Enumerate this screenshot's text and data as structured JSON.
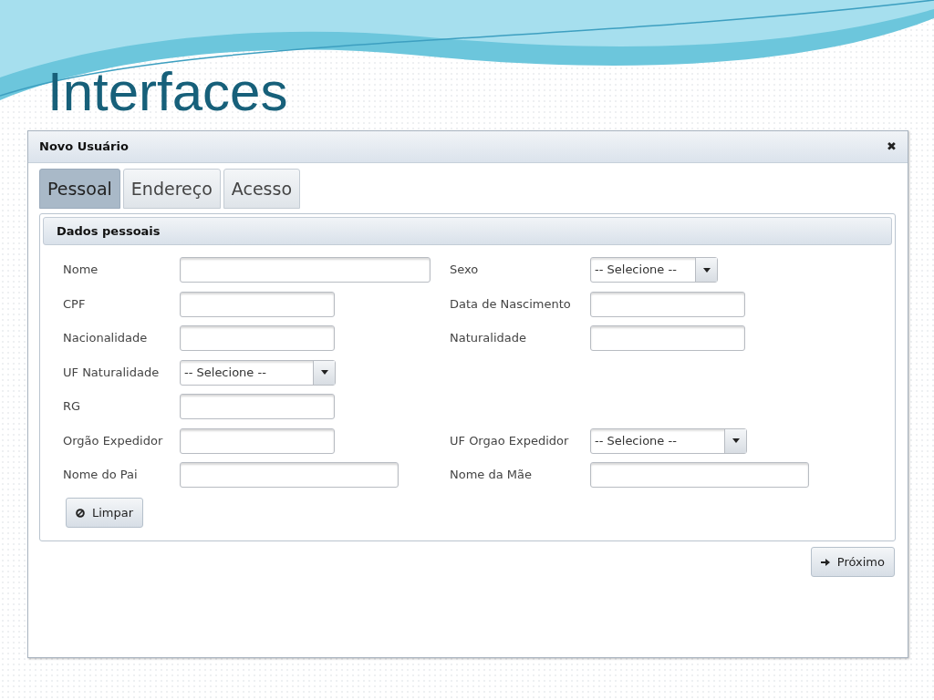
{
  "slide": {
    "title": "Interfaces"
  },
  "window": {
    "title": "Novo Usuário",
    "close": "✖"
  },
  "tabs": [
    {
      "label": "Pessoal",
      "selected": true
    },
    {
      "label": "Endereço",
      "selected": false
    },
    {
      "label": "Acesso",
      "selected": false
    }
  ],
  "section": {
    "title": "Dados pessoais"
  },
  "form": {
    "rows": [
      {
        "left": {
          "label": "Nome",
          "kind": "text"
        },
        "right": {
          "label": "Sexo",
          "kind": "select",
          "value": "-- Selecione --"
        }
      },
      {
        "left": {
          "label": "CPF",
          "kind": "text"
        },
        "right": {
          "label": "Data de Nascimento",
          "kind": "text"
        }
      },
      {
        "left": {
          "label": "Nacionalidade",
          "kind": "text"
        },
        "right": {
          "label": "Naturalidade",
          "kind": "text"
        }
      },
      {
        "left": {
          "label": "UF Naturalidade",
          "kind": "select",
          "value": "-- Selecione --"
        }
      },
      {
        "left": {
          "label": "RG",
          "kind": "text"
        }
      },
      {
        "left": {
          "label": "Orgão Expedidor",
          "kind": "text"
        },
        "right": {
          "label": "UF Orgao Expedidor",
          "kind": "select",
          "value": "-- Selecione --"
        }
      },
      {
        "left": {
          "label": "Nome do Pai",
          "kind": "text"
        },
        "right": {
          "label": "Nome da Mãe",
          "kind": "text"
        }
      }
    ]
  },
  "clear_button": {
    "label": "Limpar"
  },
  "next_button": {
    "label": "Próximo"
  }
}
